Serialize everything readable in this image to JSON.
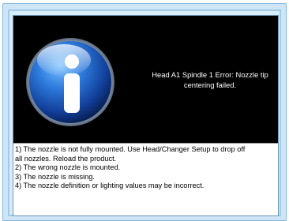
{
  "dialog": {
    "error_message": "Head A1 Spindle 1 Error: Nozzle tip centering failed.",
    "icon": "info-icon",
    "details": [
      "1) The nozzle is not fully mounted. Use Head/Changer Setup to drop off",
      "all nozzles. Reload the product.",
      "2) The wrong nozzle is mounted.",
      "3) The nozzle is missing.",
      "4) The nozzle definition or lighting values may be incorrect."
    ]
  },
  "colors": {
    "panel_background": "#000000",
    "icon_blue": "#1f5fbf",
    "frame_blue": "#9ecbe9"
  }
}
